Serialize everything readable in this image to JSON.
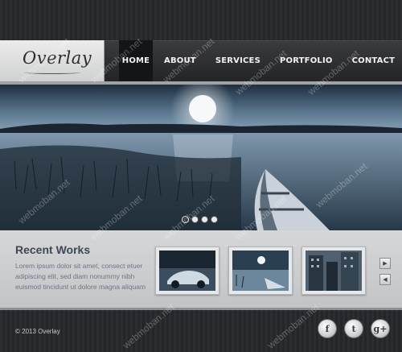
{
  "logo": {
    "text": "Overlay"
  },
  "nav": [
    {
      "label": "HOME",
      "active": true
    },
    {
      "label": "ABOUT",
      "active": false
    },
    {
      "label": "SERVICES",
      "active": false
    },
    {
      "label": "PORTFOLIO",
      "active": false
    },
    {
      "label": "CONTACT",
      "active": false
    }
  ],
  "slider": {
    "slide_count": 4,
    "active_index": 1
  },
  "works": {
    "title": "Recent Works",
    "text": "Lorem ipsum dolor sit amet, consect etuer adipiscing elit, sed diam nonummy nibh euismod tincidunt ut dolore magna aliquam",
    "thumbnails": [
      "car-thumbnail",
      "moon-lake-thumbnail",
      "city-thumbnail"
    ],
    "next_icon": "▶",
    "prev_icon": "◀"
  },
  "footer": {
    "copyright": "© 2013 Overlay",
    "social": [
      {
        "name": "facebook-icon",
        "glyph": "f"
      },
      {
        "name": "twitter-icon",
        "glyph": "t"
      },
      {
        "name": "google-plus-icon",
        "glyph": "g+"
      }
    ]
  },
  "watermark": "webmoban.net",
  "colors": {
    "accent_dark": "#141517",
    "heading": "#3e4756",
    "body_text": "#6c7686"
  }
}
